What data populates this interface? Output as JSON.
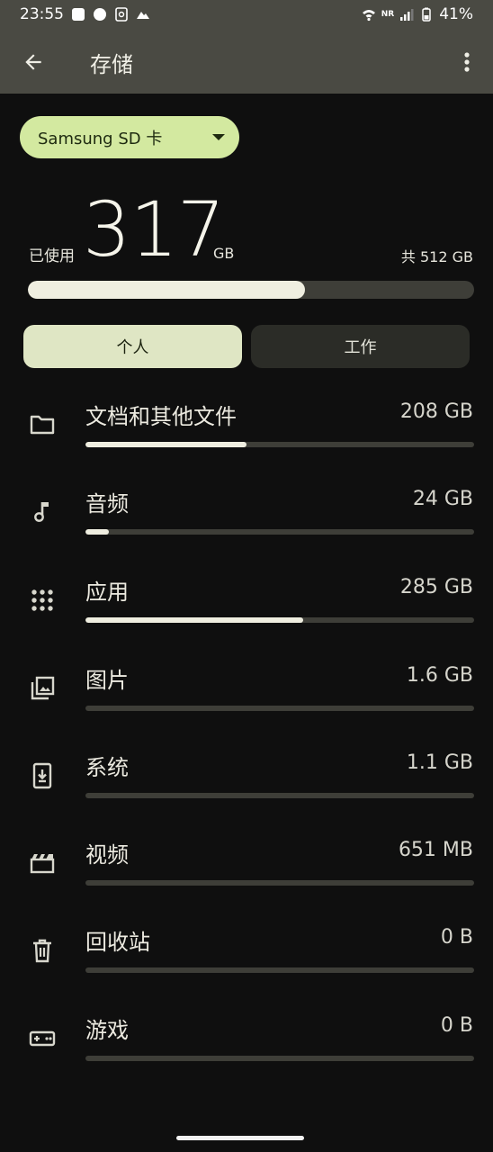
{
  "status_bar": {
    "time": "23:55",
    "battery": "41%",
    "network_label": "NR"
  },
  "app_bar": {
    "title": "存储"
  },
  "volume_selector": {
    "label": "Samsung SD 卡"
  },
  "usage": {
    "used_prefix": "已使用",
    "used_value": "317",
    "used_unit": "GB",
    "total_label": "共 512 GB",
    "used_fraction": 0.62
  },
  "tabs": [
    {
      "label": "个人",
      "selected": true
    },
    {
      "label": "工作",
      "selected": false
    }
  ],
  "categories": [
    {
      "name": "文档和其他文件",
      "size": "208 GB",
      "fraction": 0.415,
      "icon": "folder-icon"
    },
    {
      "name": "音频",
      "size": "24 GB",
      "fraction": 0.06,
      "icon": "music-note-icon"
    },
    {
      "name": "应用",
      "size": "285 GB",
      "fraction": 0.56,
      "icon": "apps-grid-icon"
    },
    {
      "name": "图片",
      "size": "1.6 GB",
      "fraction": 0.0,
      "icon": "photo-library-icon"
    },
    {
      "name": "系统",
      "size": "1.1 GB",
      "fraction": 0.0,
      "icon": "system-update-icon"
    },
    {
      "name": "视频",
      "size": "651 MB",
      "fraction": 0.0,
      "icon": "movie-icon"
    },
    {
      "name": "回收站",
      "size": "0 B",
      "fraction": 0.0,
      "icon": "trash-icon"
    },
    {
      "name": "游戏",
      "size": "0 B",
      "fraction": 0.0,
      "icon": "gamepad-icon"
    }
  ],
  "colors": {
    "accent_chip": "#d3e9a0",
    "bar_fill": "#efeee0",
    "bar_track": "#3e3e38",
    "app_bar": "#4a4a43"
  }
}
